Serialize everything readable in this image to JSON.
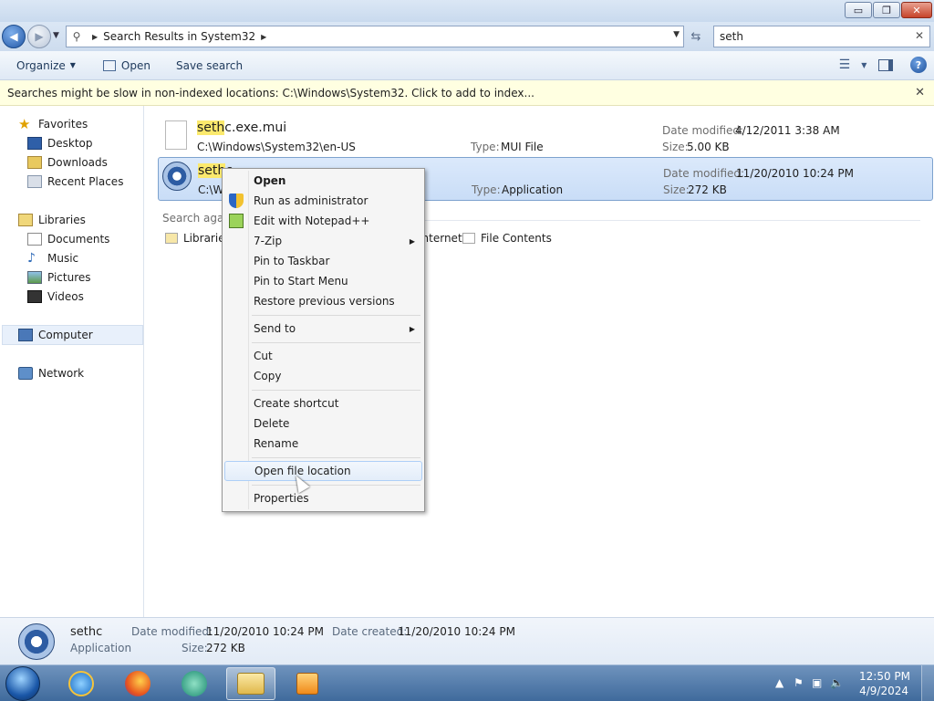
{
  "window": {
    "caption": {
      "minimize": "▭",
      "maximize": "❐",
      "close": "✕"
    }
  },
  "address": {
    "path": "Search Results in System32",
    "search_value": "seth"
  },
  "toolbar": {
    "organize": "Organize",
    "open": "Open",
    "save_search": "Save search"
  },
  "infobar": {
    "message": "Searches might be slow in non-indexed locations: C:\\Windows\\System32. Click to add to index..."
  },
  "nav": {
    "favorites": "Favorites",
    "desktop": "Desktop",
    "downloads": "Downloads",
    "recent_places": "Recent Places",
    "libraries": "Libraries",
    "documents": "Documents",
    "music": "Music",
    "pictures": "Pictures",
    "videos": "Videos",
    "computer": "Computer",
    "network": "Network"
  },
  "results": [
    {
      "name_hl": "seth",
      "name_rest": "c.exe.mui",
      "path": "C:\\Windows\\System32\\en-US",
      "type_label": "Type:",
      "type": "MUI File",
      "date_label": "Date modified:",
      "date": "4/12/2011 3:38 AM",
      "size_label": "Size:",
      "size": "5.00 KB"
    },
    {
      "name_hl": "seth",
      "name_rest": "c",
      "path": "C:\\W",
      "type_label": "Type:",
      "type": "Application",
      "date_label": "Date modified:",
      "date": "11/20/2010 10:24 PM",
      "size_label": "Size:",
      "size": "272 KB"
    }
  ],
  "search_again": {
    "label": "Search again",
    "libraries": "Libraries",
    "internet": "Internet",
    "file_contents": "File Contents"
  },
  "context_menu": {
    "open": "Open",
    "run_as_admin": "Run as administrator",
    "edit_notepad": "Edit with Notepad++",
    "seven_zip": "7-Zip",
    "pin_taskbar": "Pin to Taskbar",
    "pin_start": "Pin to Start Menu",
    "restore_versions": "Restore previous versions",
    "send_to": "Send to",
    "cut": "Cut",
    "copy": "Copy",
    "create_shortcut": "Create shortcut",
    "delete": "Delete",
    "rename": "Rename",
    "open_file_location": "Open file location",
    "properties": "Properties"
  },
  "details": {
    "name": "sethc",
    "type": "Application",
    "date_modified_label": "Date modified:",
    "date_modified": "11/20/2010 10:24 PM",
    "date_created_label": "Date created:",
    "date_created": "11/20/2010 10:24 PM",
    "size_label": "Size:",
    "size": "272 KB"
  },
  "taskbar": {
    "time": "12:50 PM",
    "date": "4/9/2024"
  },
  "colors": {
    "highlight": "#fbe96d",
    "selection": "#c9ddf7",
    "infobar": "#ffffe1",
    "taskbar": "#3f6a9c"
  }
}
